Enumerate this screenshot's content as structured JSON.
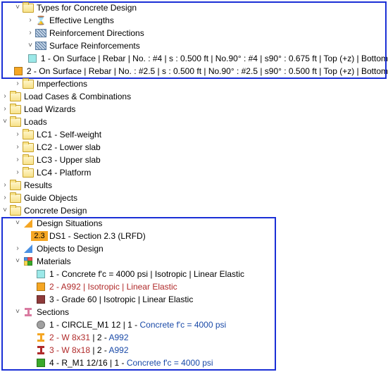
{
  "tree": {
    "typesForConcreteDesign": "Types for Concrete Design",
    "effLengths": "Effective Lengths",
    "reinfDirs": "Reinforcement Directions",
    "surfReinf": "Surface Reinforcements",
    "surfReinf1": "1 - On Surface | Rebar | No. : #4 | s : 0.500 ft | No.90° : #4 | s90° : 0.675 ft | Top (+z) | Bottom",
    "surfReinf2": "2 - On Surface | Rebar | No. : #2.5 | s : 0.500 ft | No.90° : #2.5 | s90° : 0.500 ft | Top (+z) | Bottom",
    "imperfections": "Imperfections",
    "lcCombos": "Load Cases & Combinations",
    "loadWizards": "Load Wizards",
    "loads": "Loads",
    "lc1": "LC1 - Self-weight",
    "lc2": "LC2 - Lower slab",
    "lc3": "LC3 - Upper slab",
    "lc4": "LC4 - Platform",
    "results": "Results",
    "guideObjs": "Guide Objects",
    "concreteDesign": "Concrete Design",
    "designSituations": "Design Situations",
    "dsBadge": "2.3",
    "ds1": "DS1 - Section 2.3 (LRFD)",
    "objectsToDesign": "Objects to Design",
    "materials": "Materials",
    "mat1": "1 - Concrete f'c = 4000 psi | Isotropic | Linear Elastic",
    "mat2": "2 - A992 | Isotropic | Linear Elastic",
    "mat3": "3 - Grade 60 | Isotropic | Linear Elastic",
    "sections": "Sections",
    "sec1a": "1 - CIRCLE_M1 12 | 1 - ",
    "sec1b": "Concrete f'c = 4000 psi",
    "sec2a": "2 - W 8x31",
    "sec2b": " | 2 - ",
    "sec2c": "A992",
    "sec3a": "3 - W 8x18",
    "sec3b": " | 2 - ",
    "sec3c": "A992",
    "sec4a": "4 - R_M1 12/16 | 1 - ",
    "sec4b": "Concrete f'c = 4000 psi"
  }
}
